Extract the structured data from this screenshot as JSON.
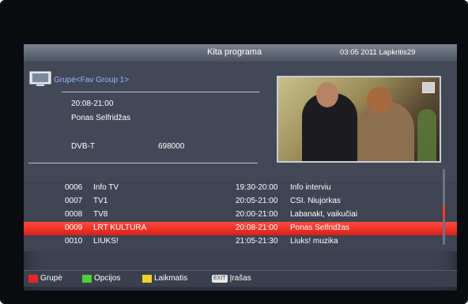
{
  "header": {
    "title": "Kita programa",
    "datetime": "03:05 2011 Lapkritis29"
  },
  "info": {
    "group": "Grupė<Fav Group 1>",
    "event_time": "20:08-21:00",
    "event_name": "Ponas Selfridžas",
    "tuner": "DVB-T",
    "frequency": "698000"
  },
  "channels": [
    {
      "num": "0006",
      "name": "Info TV",
      "time": "19:30-20:00",
      "program": "Info interviu"
    },
    {
      "num": "0007",
      "name": "TV1",
      "time": "20:05-21:00",
      "program": "CSI. Niujorkas"
    },
    {
      "num": "0008",
      "name": "TV8",
      "time": "20:00-21:00",
      "program": "Labanakt, vaikučiai"
    },
    {
      "num": "0009",
      "name": "LRT KULTURA",
      "time": "20:08-21:00",
      "program": "Ponas Selfridžas"
    },
    {
      "num": "0010",
      "name": "LIUKS!",
      "time": "21:05-21:30",
      "program": "Liuks! muzika"
    }
  ],
  "selected_index": 3,
  "footer": {
    "red_label": "Grupė",
    "green_label": "Opcijos",
    "yellow_label": "Laikmatis",
    "exit_key": "EXIT",
    "exit_label": "Įrašas"
  },
  "colors": {
    "red": "#e8262a",
    "green": "#4ccf3a",
    "yellow": "#f2d22b",
    "selection": "#e3281e"
  },
  "icons": {
    "group": "tv-monitor-icon"
  }
}
